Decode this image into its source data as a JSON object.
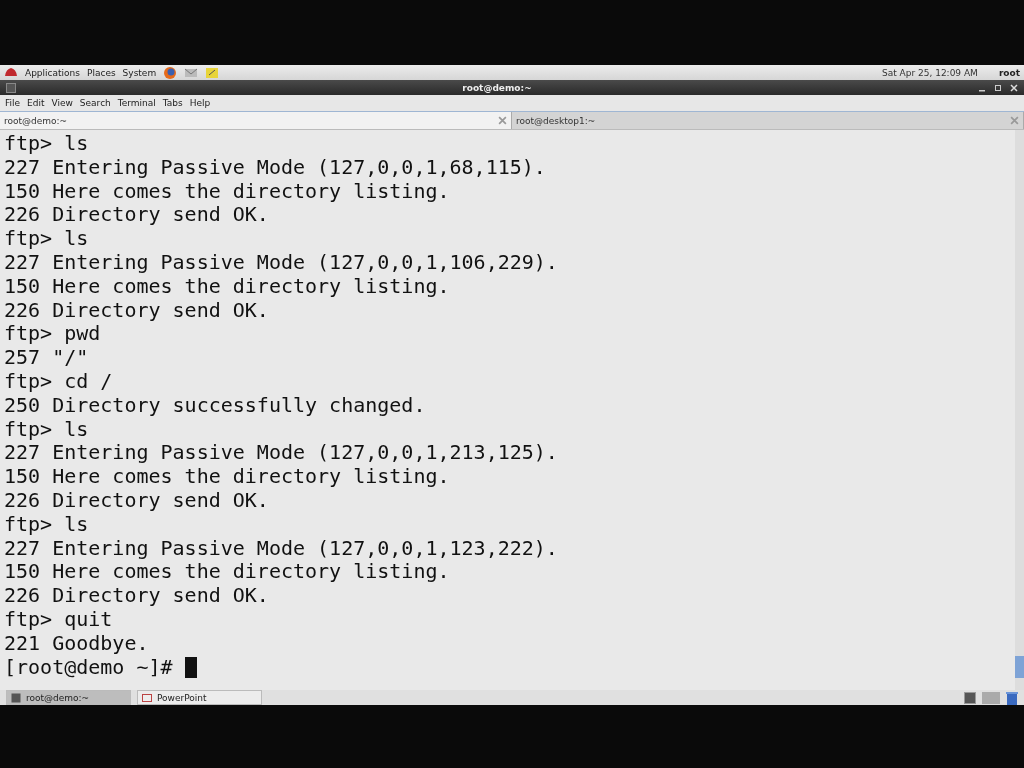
{
  "top_panel": {
    "menus": [
      "Applications",
      "Places",
      "System"
    ],
    "clock": "Sat Apr 25, 12:09 AM",
    "user": "root"
  },
  "window": {
    "title": "root@demo:~"
  },
  "menu_bar": [
    "File",
    "Edit",
    "View",
    "Search",
    "Terminal",
    "Tabs",
    "Help"
  ],
  "tabs": [
    {
      "label": "root@demo:~",
      "selected": true
    },
    {
      "label": "root@desktop1:~",
      "selected": false
    }
  ],
  "terminal": {
    "lines": [
      "ftp> ls",
      "227 Entering Passive Mode (127,0,0,1,68,115).",
      "150 Here comes the directory listing.",
      "226 Directory send OK.",
      "ftp> ls",
      "227 Entering Passive Mode (127,0,0,1,106,229).",
      "150 Here comes the directory listing.",
      "226 Directory send OK.",
      "ftp> pwd",
      "257 \"/\"",
      "ftp> cd /",
      "250 Directory successfully changed.",
      "ftp> ls",
      "227 Entering Passive Mode (127,0,0,1,213,125).",
      "150 Here comes the directory listing.",
      "226 Directory send OK.",
      "ftp> ls",
      "227 Entering Passive Mode (127,0,0,1,123,222).",
      "150 Here comes the directory listing.",
      "226 Directory send OK.",
      "ftp> quit",
      "221 Goodbye."
    ],
    "prompt": "[root@demo ~]#"
  },
  "taskbar": [
    {
      "label": "root@demo:~",
      "selected": true,
      "kind": "terminal"
    },
    {
      "label": "PowerPoint",
      "selected": false,
      "kind": "document"
    }
  ]
}
